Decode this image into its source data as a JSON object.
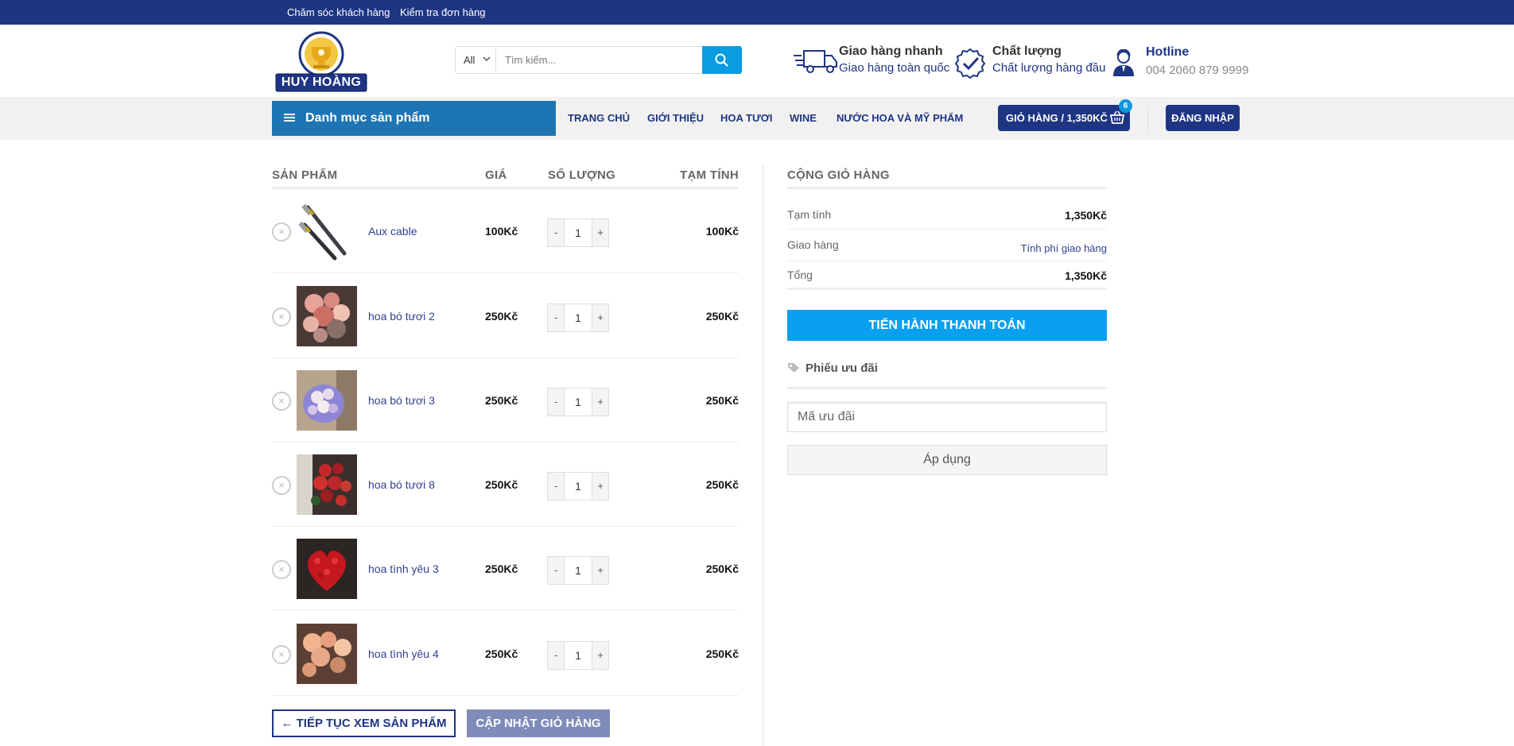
{
  "topbar": {
    "links": [
      "Chăm sóc khách hàng",
      "Kiểm tra đơn hàng"
    ]
  },
  "header": {
    "logo_text": "HUY HOÀNG",
    "search": {
      "category": "All",
      "placeholder": "Tìm kiếm..."
    },
    "features": [
      {
        "icon": "truck-icon",
        "title": "Giao hàng nhanh",
        "subtitle": "Giao hàng toàn quốc"
      },
      {
        "icon": "quality-check-icon",
        "title": "Chất lượng",
        "subtitle": "Chất lượng hàng đầu"
      },
      {
        "icon": "support-agent-icon",
        "title": "Hotline",
        "subtitle": "004 2060 879 9999"
      }
    ]
  },
  "nav": {
    "category_menu": "Danh mục sản phẩm",
    "links": [
      "TRANG CHỦ",
      "GIỚI THIỆU",
      "HOA TƯƠI",
      "WINE",
      "NƯỚC HOA VÀ MỸ PHẨM"
    ],
    "cart_label": "GIỎ HÀNG / 1,350KČ",
    "cart_count": "6",
    "login_label": "ĐĂNG NHẬP"
  },
  "cart": {
    "headers": {
      "product": "SẢN PHẨM",
      "price": "GIÁ",
      "quantity": "SỐ LƯỢNG",
      "subtotal": "TẠM TÍNH"
    },
    "items": [
      {
        "name": "Aux cable",
        "price": "100Kč",
        "qty": "1",
        "subtotal": "100Kč",
        "thumb": "cable"
      },
      {
        "name": "hoa bó tươi 2",
        "price": "250Kč",
        "qty": "1",
        "subtotal": "250Kč",
        "thumb": "bouquet-pink"
      },
      {
        "name": "hoa bó tươi 3",
        "price": "250Kč",
        "qty": "1",
        "subtotal": "250Kč",
        "thumb": "bouquet-purple"
      },
      {
        "name": "hoa bó tươi 8",
        "price": "250Kč",
        "qty": "1",
        "subtotal": "250Kč",
        "thumb": "bouquet-red"
      },
      {
        "name": "hoa tình yêu 3",
        "price": "250Kč",
        "qty": "1",
        "subtotal": "250Kč",
        "thumb": "heart-roses"
      },
      {
        "name": "hoa tình yêu 4",
        "price": "250Kč",
        "qty": "1",
        "subtotal": "250Kč",
        "thumb": "bouquet-peach"
      }
    ],
    "minus": "-",
    "plus": "+",
    "remove": "×",
    "continue_label": "← TIẾP TỤC XEM SẢN PHẨM",
    "update_label": "CẬP NHẬT GIỎ HÀNG"
  },
  "totals": {
    "heading": "CỘNG GIỎ HÀNG",
    "subtotal_label": "Tạm tính",
    "subtotal_value": "1,350Kč",
    "shipping_label": "Giao hàng",
    "shipping_value": "Tính phí giao hàng",
    "total_label": "Tổng",
    "total_value": "1,350Kč",
    "checkout_label": "TIẾN HÀNH THANH TOÁN",
    "coupon_heading": "Phiếu ưu đãi",
    "coupon_placeholder": "Mã ưu đãi",
    "apply_label": "Áp dụng"
  },
  "colors": {
    "brand_navy": "#1e3583",
    "accent_blue": "#0aa0f0",
    "menu_blue": "#1d75b4"
  }
}
